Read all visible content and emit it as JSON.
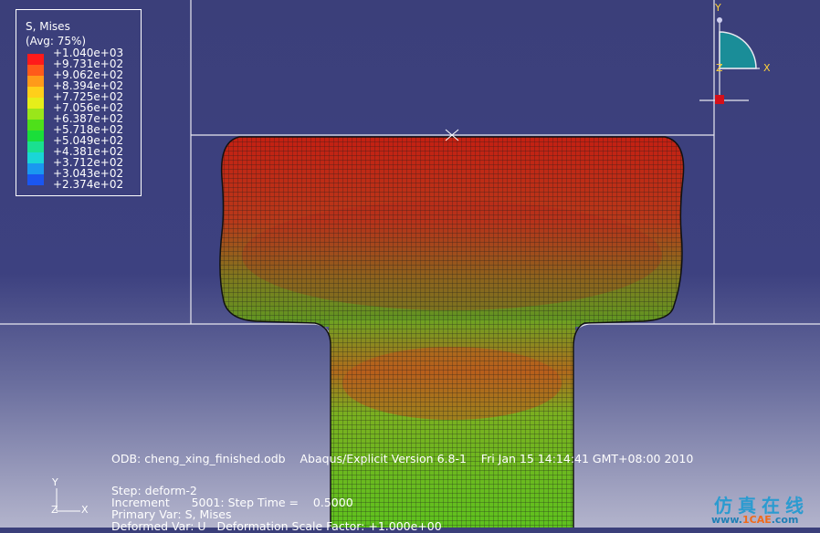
{
  "legend": {
    "title": "S, Mises",
    "subtitle": "(Avg: 75%)",
    "entries": [
      {
        "label": "+1.040e+03",
        "color": "#ff1a1a"
      },
      {
        "label": "+9.731e+02",
        "color": "#ff5a1a"
      },
      {
        "label": "+9.062e+02",
        "color": "#ff9a1a"
      },
      {
        "label": "+8.394e+02",
        "color": "#ffcf1a"
      },
      {
        "label": "+7.725e+02",
        "color": "#e6ee1a"
      },
      {
        "label": "+7.056e+02",
        "color": "#9ae61a"
      },
      {
        "label": "+6.387e+02",
        "color": "#4ee01a"
      },
      {
        "label": "+5.718e+02",
        "color": "#1ade3a"
      },
      {
        "label": "+5.049e+02",
        "color": "#1ae090"
      },
      {
        "label": "+4.381e+02",
        "color": "#1ad6d6"
      },
      {
        "label": "+3.712e+02",
        "color": "#1a98f0"
      },
      {
        "label": "+3.043e+02",
        "color": "#1a56f0"
      },
      {
        "label": "+2.374e+02",
        "color": "#1a1aff"
      }
    ]
  },
  "triad": {
    "y_label": "Y",
    "x_label": "X",
    "z_label": "Z"
  },
  "small_axes": {
    "y_label": "Y",
    "x_label": "X",
    "z_label": "Z"
  },
  "info": {
    "odb_line": "ODB: cheng_xing_finished.odb    Abaqus/Explicit Version 6.8-1    Fri Jan 15 14:14:41 GMT+08:00 2010",
    "step_line": "Step: deform-2",
    "increment_line": "Increment      5001: Step Time =    0.5000",
    "primary_line": "Primary Var: S, Mises",
    "deformed_line": "Deformed Var: U   Deformation Scale Factor: +1.000e+00"
  },
  "watermark": {
    "chinese": "仿真在线",
    "url_prefix": "www.",
    "url_brand": "1CAE",
    "url_suffix": ".com"
  },
  "colors": {
    "background_top": "#3b3f7a",
    "background_bottom": "#b3b4cc",
    "mesh_red": "#cc2a1a",
    "mesh_green": "#5cc21e"
  }
}
